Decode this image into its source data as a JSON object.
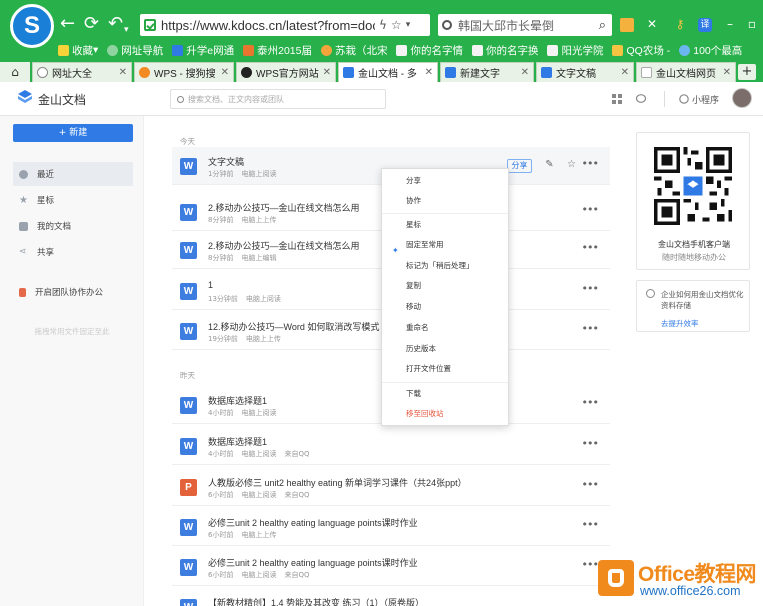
{
  "browser": {
    "url": "https://www.kdocs.cn/latest?from=docs",
    "search_text": "韩国大邱市长晕倒",
    "bookmarks": [
      "收藏",
      "网址导航",
      "升学e网通",
      "泰州2015届",
      "苏栽（北宋",
      "你的名字情",
      "你的名字换",
      "阳光学院",
      "QQ农场 -",
      "100个最高"
    ],
    "tabs": [
      {
        "label": "网址大全",
        "active": false
      },
      {
        "label": "WPS - 搜狗搜",
        "active": false
      },
      {
        "label": "WPS官方网站",
        "active": false
      },
      {
        "label": "金山文档 - 多",
        "active": true
      },
      {
        "label": "新建文字",
        "active": false
      },
      {
        "label": "文字文稿",
        "active": false
      },
      {
        "label": "金山文档网页",
        "active": false
      }
    ]
  },
  "app": {
    "name": "金山文档",
    "search_placeholder": "搜索文档、正文内容或团队",
    "mini_program": "小程序"
  },
  "sidebar": {
    "new_button": "+ 新建",
    "items": [
      {
        "label": "最近",
        "selected": true
      },
      {
        "label": "星标",
        "selected": false
      },
      {
        "label": "我的文档",
        "selected": false
      },
      {
        "label": "共享",
        "selected": false
      },
      {
        "label": "开启团队协作办公",
        "selected": false
      }
    ],
    "hint": "拖拽常用文件固定至此"
  },
  "list": {
    "today_label": "今天",
    "yesterday_label": "昨天",
    "share_label": "分享",
    "files": [
      {
        "name": "文字文稿",
        "time": "1分钟前",
        "action": "电脑上阅读",
        "source": "",
        "type": "W"
      },
      {
        "name": "2.移动办公技巧—金山在线文档怎么用",
        "time": "8分钟前",
        "action": "电脑上上传",
        "source": "",
        "type": "W"
      },
      {
        "name": "2.移动办公技巧—金山在线文档怎么用",
        "time": "8分钟前",
        "action": "电脑上编辑",
        "source": "",
        "type": "W"
      },
      {
        "name": "1",
        "time": "13分钟前",
        "action": "电脑上阅读",
        "source": "",
        "type": "W"
      },
      {
        "name": "12.移动办公技巧—Word 如何取消改写模式",
        "time": "19分钟前",
        "action": "电脑上上传",
        "source": "",
        "type": "W"
      },
      {
        "name": "数据库选择题1",
        "time": "4小时前",
        "action": "电脑上阅读",
        "source": "",
        "type": "W"
      },
      {
        "name": "数据库选择题1",
        "time": "4小时前",
        "action": "电脑上阅读",
        "source": "来自QQ",
        "type": "W"
      },
      {
        "name": "人教版必修三 unit2 healthy eating 新单词学习课件（共24张ppt）",
        "time": "6小时前",
        "action": "电脑上阅读",
        "source": "来自QQ",
        "type": "P"
      },
      {
        "name": "必修三unit 2 healthy eating language points课时作业",
        "time": "6小时前",
        "action": "电脑上上传",
        "source": "",
        "type": "W"
      },
      {
        "name": "必修三unit 2 healthy eating language points课时作业",
        "time": "6小时前",
        "action": "电脑上阅读",
        "source": "来自QQ",
        "type": "W"
      },
      {
        "name": "【新教材精创】1.4 势能及其改变 练习（1）（原卷版）",
        "time": "",
        "action": "",
        "source": "",
        "type": "W"
      }
    ]
  },
  "context_menu": {
    "items": [
      "分享",
      "协作",
      "星标",
      "固定至常用",
      "标记为「稍后处理」",
      "复制",
      "移动",
      "重命名",
      "历史版本",
      "打开文件位置",
      "下载",
      "移至回收站"
    ]
  },
  "right_panel": {
    "qr_title": "金山文档手机客户端",
    "qr_subtitle": "随时随地移动办公",
    "tip_text": "企业如何用金山文档优化资料存储",
    "tip_link": "去提升效率"
  },
  "watermark": {
    "title": "Office教程网",
    "url": "www.office26.com"
  },
  "colors": {
    "browser_green": "#28b04a",
    "accent_blue": "#2f7ae5",
    "danger": "#e6543b",
    "ppt_orange": "#e4623a"
  }
}
